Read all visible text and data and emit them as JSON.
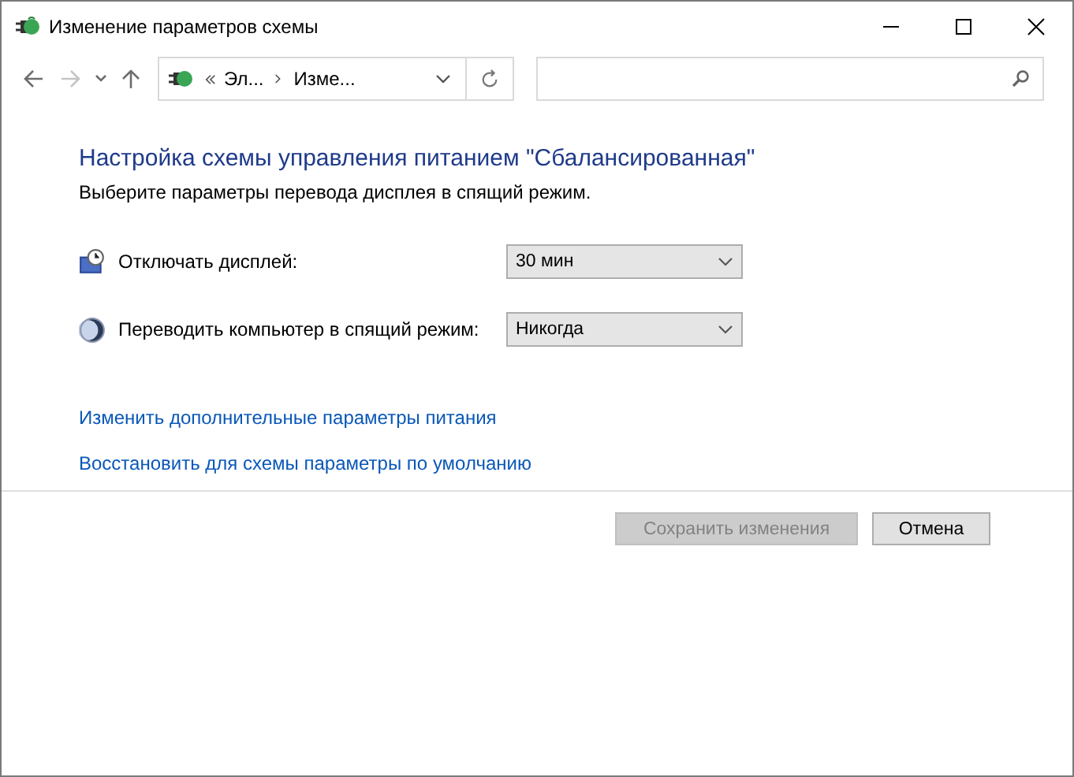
{
  "window": {
    "title": "Изменение параметров схемы"
  },
  "nav_buttons": [
    {
      "kind": "back",
      "disabled": false
    },
    {
      "kind": "forward",
      "disabled": true
    },
    {
      "kind": "recent",
      "disabled": false
    },
    {
      "kind": "up",
      "disabled": false
    }
  ],
  "address": {
    "crumbs": [
      "Эл...",
      "Изме..."
    ]
  },
  "heading": "Настройка схемы управления питанием \"Сбалансированная\"",
  "description": "Выберите параметры перевода дисплея в спящий режим.",
  "settings": [
    {
      "kind": "display",
      "label": "Отключать дисплей:",
      "value": "30 мин"
    },
    {
      "kind": "sleep",
      "label": "Переводить компьютер в спящий режим:",
      "value": "Никогда"
    }
  ],
  "links": [
    "Изменить дополнительные параметры питания",
    "Восстановить для схемы параметры по умолчанию"
  ],
  "buttons": [
    {
      "label": "Сохранить изменения",
      "disabled": true
    },
    {
      "label": "Отмена",
      "disabled": false
    }
  ]
}
